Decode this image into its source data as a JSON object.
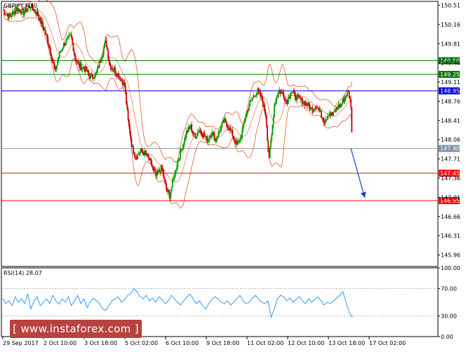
{
  "chart_data": {
    "type": "candlestick",
    "title": "GBPJPY,M30",
    "y_range": [
      145.75,
      150.58
    ],
    "y_ticks": [
      "150.51",
      "150.16",
      "149.81",
      "149.46",
      "149.11",
      "148.76",
      "148.41",
      "148.06",
      "147.71",
      "147.36",
      "147.01",
      "146.66",
      "146.31",
      "145.96"
    ],
    "x_ticks": [
      "29 Sep 2017",
      "2 Oct 10:00",
      "3 Oct 18:00",
      "5 Oct 02:00",
      "6 Oct 10:00",
      "9 Oct 18:00",
      "11 Oct 02:00",
      "12 Oct 10:00",
      "13 Oct 18:00",
      "17 Oct 02:00"
    ],
    "levels": [
      {
        "value": 149.5,
        "label": "149.50",
        "color": "#007a00"
      },
      {
        "value": 149.25,
        "label": "149.25",
        "color": "#007a00"
      },
      {
        "value": 148.95,
        "label": "148.95",
        "color": "#0000e0"
      },
      {
        "value": 147.9,
        "label": "147.90",
        "color": "#7f8fa6"
      },
      {
        "value": 147.45,
        "label": "147.45",
        "color": "#ff0000"
      },
      {
        "value": 146.95,
        "label": "146.95",
        "color": "#ff0000"
      }
    ],
    "price_path": [
      [
        0,
        150.42
      ],
      [
        10,
        150.3
      ],
      [
        20,
        150.45
      ],
      [
        30,
        150.38
      ],
      [
        40,
        150.5
      ],
      [
        50,
        150.35
      ],
      [
        60,
        150.05
      ],
      [
        68,
        149.7
      ],
      [
        75,
        149.3
      ],
      [
        82,
        149.65
      ],
      [
        90,
        149.85
      ],
      [
        98,
        149.95
      ],
      [
        104,
        149.55
      ],
      [
        110,
        149.4
      ],
      [
        118,
        149.35
      ],
      [
        126,
        149.2
      ],
      [
        134,
        149.25
      ],
      [
        142,
        149.6
      ],
      [
        148,
        149.85
      ],
      [
        154,
        149.4
      ],
      [
        160,
        149.35
      ],
      [
        168,
        149.2
      ],
      [
        175,
        149.05
      ],
      [
        180,
        148.4
      ],
      [
        186,
        147.9
      ],
      [
        192,
        147.75
      ],
      [
        198,
        147.85
      ],
      [
        205,
        147.8
      ],
      [
        212,
        147.65
      ],
      [
        220,
        147.4
      ],
      [
        228,
        147.55
      ],
      [
        235,
        147.15
      ],
      [
        240,
        147.05
      ],
      [
        246,
        147.4
      ],
      [
        252,
        147.7
      ],
      [
        258,
        147.95
      ],
      [
        264,
        148.2
      ],
      [
        270,
        148.3
      ],
      [
        276,
        148.1
      ],
      [
        282,
        148.25
      ],
      [
        288,
        148.15
      ],
      [
        294,
        148.05
      ],
      [
        300,
        148.2
      ],
      [
        306,
        148.05
      ],
      [
        312,
        148.25
      ],
      [
        318,
        148.4
      ],
      [
        324,
        148.3
      ],
      [
        330,
        148.15
      ],
      [
        336,
        147.95
      ],
      [
        342,
        148.1
      ],
      [
        348,
        148.45
      ],
      [
        354,
        148.7
      ],
      [
        360,
        148.85
      ],
      [
        366,
        148.95
      ],
      [
        372,
        148.8
      ],
      [
        378,
        148.5
      ],
      [
        382,
        147.7
      ],
      [
        386,
        148.1
      ],
      [
        390,
        148.7
      ],
      [
        396,
        148.95
      ],
      [
        402,
        148.9
      ],
      [
        408,
        148.75
      ],
      [
        414,
        148.95
      ],
      [
        420,
        148.85
      ],
      [
        426,
        148.8
      ],
      [
        432,
        148.75
      ],
      [
        438,
        148.7
      ],
      [
        444,
        148.6
      ],
      [
        450,
        148.7
      ],
      [
        456,
        148.55
      ],
      [
        462,
        148.4
      ],
      [
        468,
        148.55
      ],
      [
        474,
        148.5
      ],
      [
        480,
        148.65
      ],
      [
        486,
        148.7
      ],
      [
        492,
        148.85
      ],
      [
        496,
        148.95
      ],
      [
        500,
        148.7
      ],
      [
        502,
        147.9
      ]
    ],
    "forecast_arrow": {
      "from": [
        500,
        147.9
      ],
      "to": [
        520,
        147.0
      ]
    },
    "rsi": {
      "label": "RSI(14) 28.07",
      "y_ticks": [
        "100.00",
        "70.00",
        "30.00",
        "0.00"
      ],
      "levels": [
        70,
        30
      ],
      "values": [
        55,
        48,
        52,
        45,
        58,
        50,
        55,
        48,
        62,
        40,
        52,
        58,
        45,
        50,
        55,
        48,
        60,
        52,
        47,
        55,
        50,
        58,
        45,
        52,
        60,
        48,
        55,
        42,
        50,
        56,
        52,
        48,
        40,
        38,
        45,
        52,
        55,
        58,
        50,
        54,
        60,
        62,
        70,
        65,
        58,
        55,
        60,
        52,
        56,
        50,
        58,
        54,
        48,
        52,
        60,
        55,
        50,
        46,
        52,
        58,
        62,
        55,
        48,
        52,
        45,
        40,
        48,
        54,
        58,
        55,
        50,
        48,
        52,
        46,
        50,
        55,
        60,
        52,
        48,
        50,
        56,
        60,
        54,
        50,
        48,
        52,
        28,
        40,
        55,
        60,
        58,
        52,
        56,
        50,
        54,
        58,
        52,
        48,
        55,
        50,
        54,
        58,
        52,
        46,
        50,
        48,
        52,
        56,
        60,
        65,
        50,
        35,
        28
      ]
    }
  },
  "watermark": "[ www.instaforex.com ]"
}
